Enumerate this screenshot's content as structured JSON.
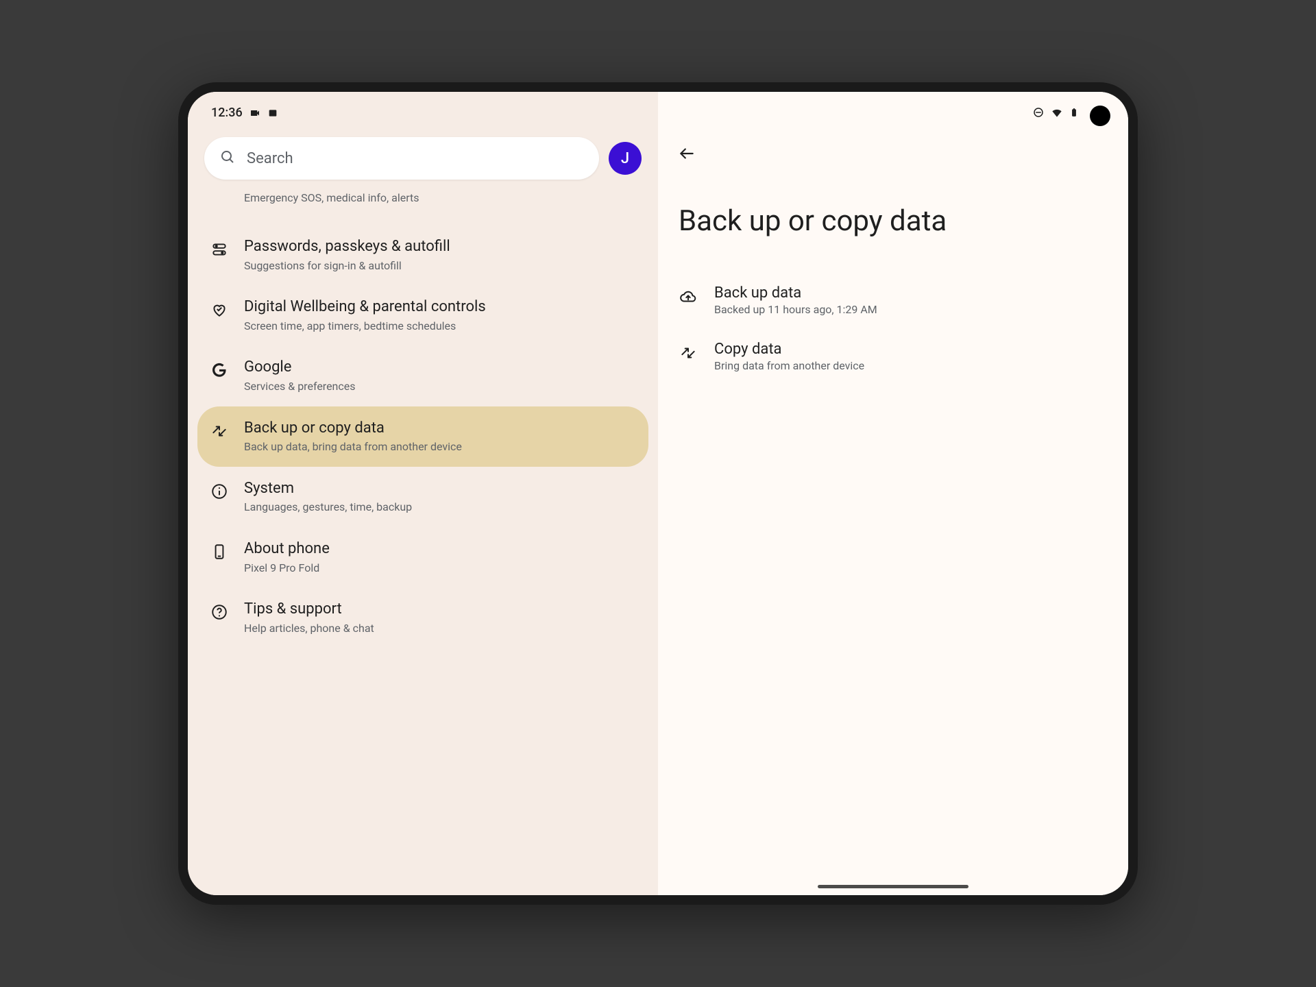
{
  "status": {
    "time": "12:36",
    "avatar_letter": "J"
  },
  "search": {
    "placeholder": "Search"
  },
  "settings": [
    {
      "icon": "none-partial",
      "title": "",
      "subtitle": "Emergency SOS, medical info, alerts",
      "selected": false,
      "partial": true,
      "id": "safety-emergency"
    },
    {
      "icon": "key",
      "title": "Passwords, passkeys & autofill",
      "subtitle": "Suggestions for sign-in & autofill",
      "selected": false,
      "id": "passwords"
    },
    {
      "icon": "wellbeing",
      "title": "Digital Wellbeing & parental controls",
      "subtitle": "Screen time, app timers, bedtime schedules",
      "selected": false,
      "id": "digital-wellbeing"
    },
    {
      "icon": "google",
      "title": "Google",
      "subtitle": "Services & preferences",
      "selected": false,
      "id": "google"
    },
    {
      "icon": "sync",
      "title": "Back up or copy data",
      "subtitle": "Back up data, bring data from another device",
      "selected": true,
      "id": "backup"
    },
    {
      "icon": "info",
      "title": "System",
      "subtitle": "Languages, gestures, time, backup",
      "selected": false,
      "id": "system"
    },
    {
      "icon": "phone",
      "title": "About phone",
      "subtitle": "Pixel 9 Pro Fold",
      "selected": false,
      "id": "about-phone"
    },
    {
      "icon": "help",
      "title": "Tips & support",
      "subtitle": "Help articles, phone & chat",
      "selected": false,
      "id": "tips-support"
    }
  ],
  "detail": {
    "page_title": "Back up or copy data",
    "items": [
      {
        "icon": "cloud",
        "title": "Back up data",
        "subtitle": "Backed up 11 hours ago, 1:29 AM",
        "id": "backup-data"
      },
      {
        "icon": "sync",
        "title": "Copy data",
        "subtitle": "Bring data from another device",
        "id": "copy-data"
      }
    ]
  }
}
